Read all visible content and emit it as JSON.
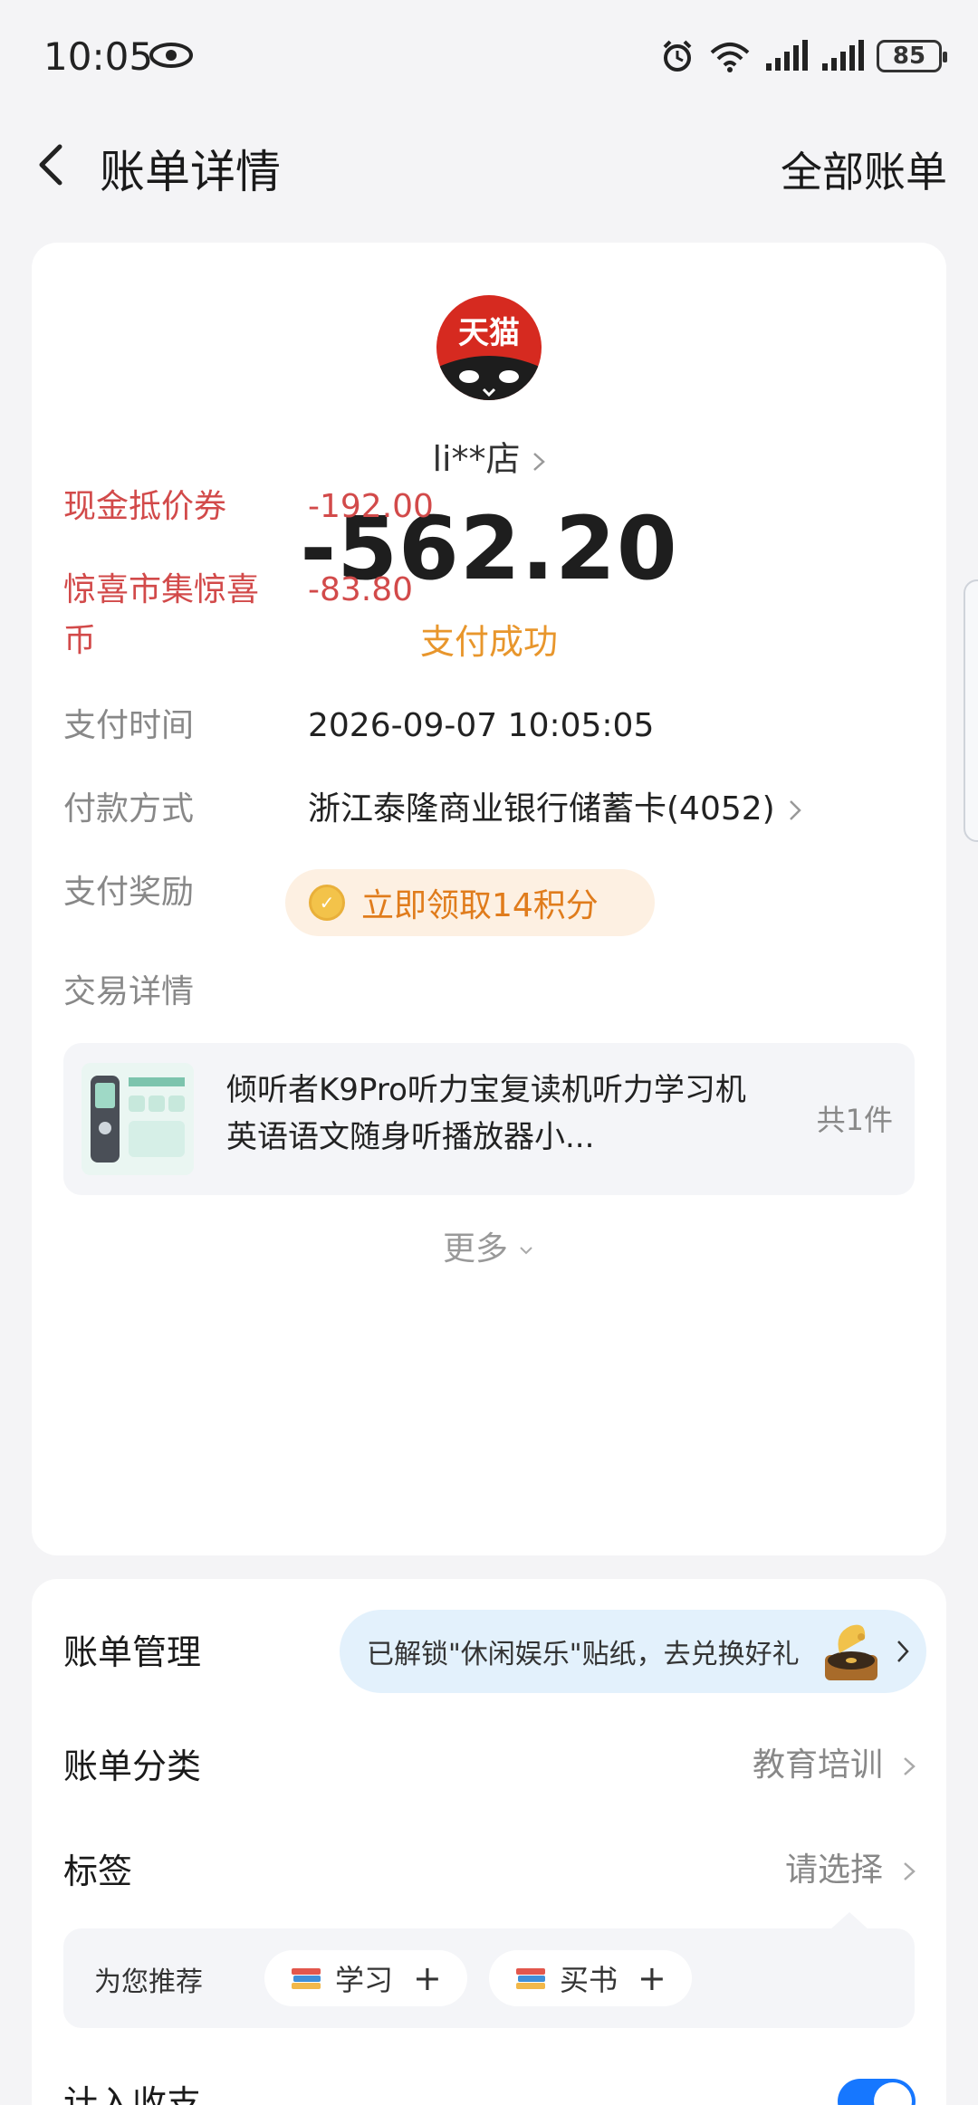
{
  "status_bar": {
    "time": "10:05",
    "battery": "85",
    "icons": [
      "eye-icon",
      "alarm-icon",
      "wifi-icon",
      "signal-icon",
      "signal-icon",
      "battery-icon"
    ]
  },
  "header": {
    "title": "账单详情",
    "right_link": "全部账单"
  },
  "merchant": {
    "logo_text": "天猫",
    "name": "li**店",
    "amount": "-562.20",
    "status": "支付成功"
  },
  "details": {
    "coupon_label": "现金抵价券",
    "coupon_value": "-192.00",
    "surprise_label": "惊喜市集惊喜币",
    "surprise_value": "-83.80",
    "pay_time_label": "支付时间",
    "pay_time_value": "2026-09-07 10:05:05",
    "pay_method_label": "付款方式",
    "pay_method_value": "浙江泰隆商业银行储蓄卡(4052)",
    "reward_label": "支付奖励",
    "reward_text": "立即领取14积分",
    "trade_label": "交易详情"
  },
  "product": {
    "title": "倾听者K9Pro听力宝复读机听力学习机英语语文随身听播放器小...",
    "count": "共1件"
  },
  "more_label": "更多",
  "bill_management": {
    "label": "账单管理",
    "sticker_text": "已解锁\"休闲娱乐\"贴纸，去兑换好礼",
    "category_label": "账单分类",
    "category_value": "教育培训",
    "tag_label": "标签",
    "tag_value": "请选择",
    "recommend_label": "为您推荐",
    "chips": [
      {
        "label": "学习",
        "plus": "+"
      },
      {
        "label": "买书",
        "plus": "+"
      }
    ],
    "income_label": "计入收支",
    "income_enabled": true
  },
  "colors": {
    "accent_red": "#d24a4a",
    "status_orange": "#e8962c",
    "toggle_blue": "#1677ff",
    "tmall_red": "#d62a20"
  }
}
